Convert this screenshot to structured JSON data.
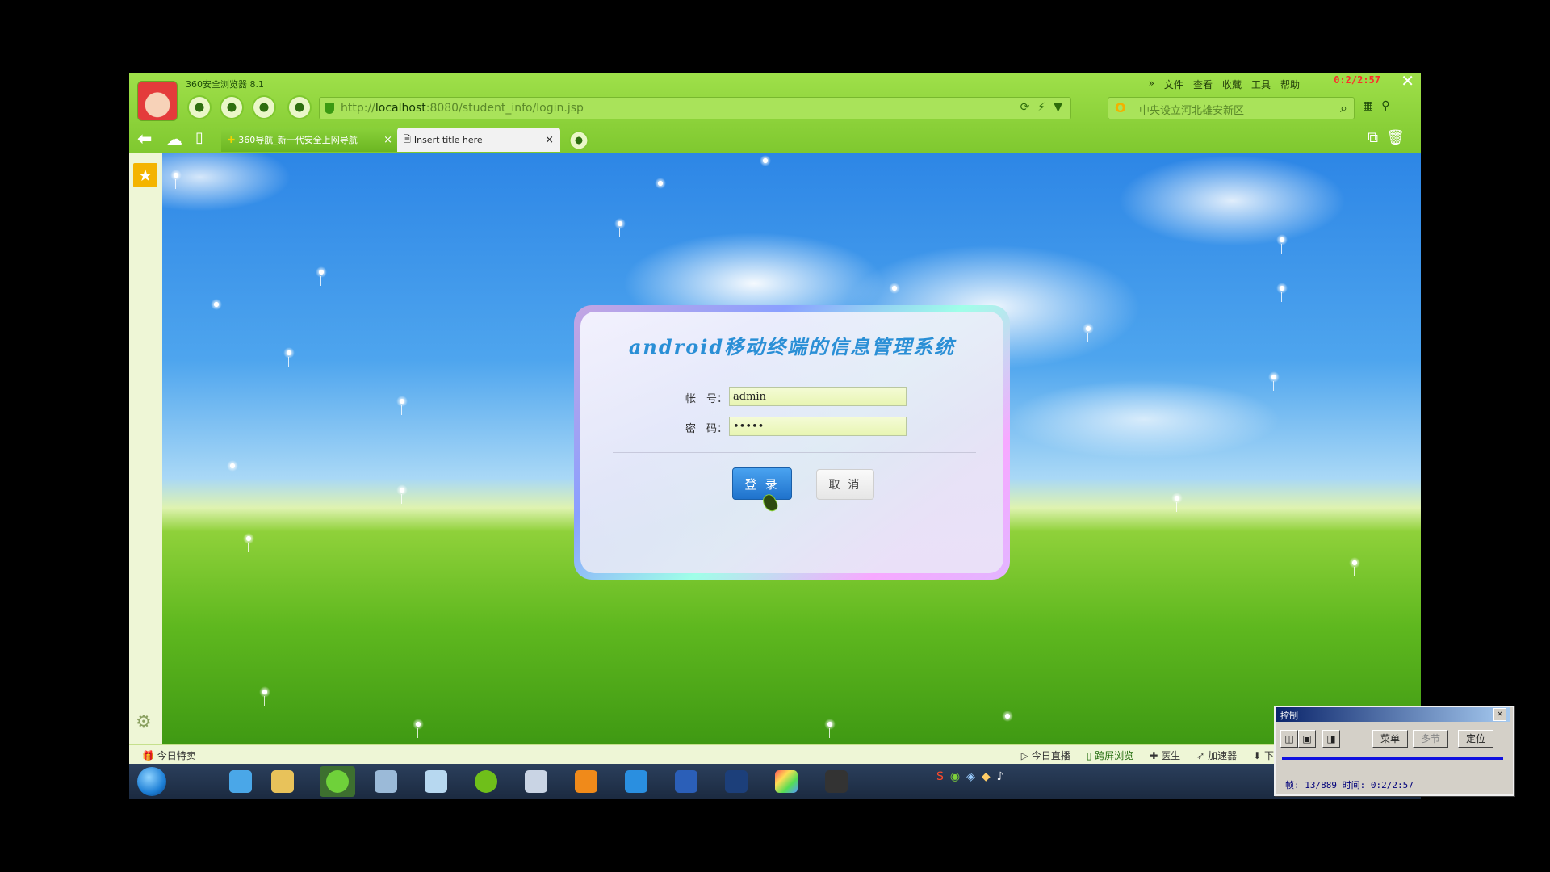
{
  "browser": {
    "app_title": "360安全浏览器 8.1",
    "menu": [
      "文件",
      "查看",
      "收藏",
      "工具",
      "帮助"
    ],
    "menu_arrow": "»",
    "recording_time": "0:2/2:57",
    "close_glyph": "✕",
    "url_scheme": "http://",
    "url_host": "localhost",
    "url_rest": ":8080/student_info/login.jsp",
    "search_placeholder": "中央设立河北雄安新区",
    "tabs": [
      {
        "label": "360导航_新一代安全上网导航",
        "close": "×"
      },
      {
        "label": "Insert title here",
        "close": "×"
      }
    ]
  },
  "login": {
    "title": "android移动终端的信息管理系统",
    "username_label": "帐　号：",
    "password_label": "密　码：",
    "username_value": "admin",
    "password_value": "•••••",
    "login_button": "登 录",
    "cancel_button": "取 消"
  },
  "statusbar": {
    "left": "今日特卖",
    "items": [
      "今日直播",
      "跨屏浏览",
      "医生",
      "加速器",
      "下载"
    ]
  },
  "recorder": {
    "title": "控制",
    "close": "×",
    "buttons": [
      "菜单",
      "多节",
      "定位"
    ],
    "status": "帧: 13/889 时间: 0:2/2:57"
  },
  "colors": {
    "browser_green": "#8ad13a",
    "title_blue": "#2a8fd6",
    "login_button": "#1f72cc"
  }
}
